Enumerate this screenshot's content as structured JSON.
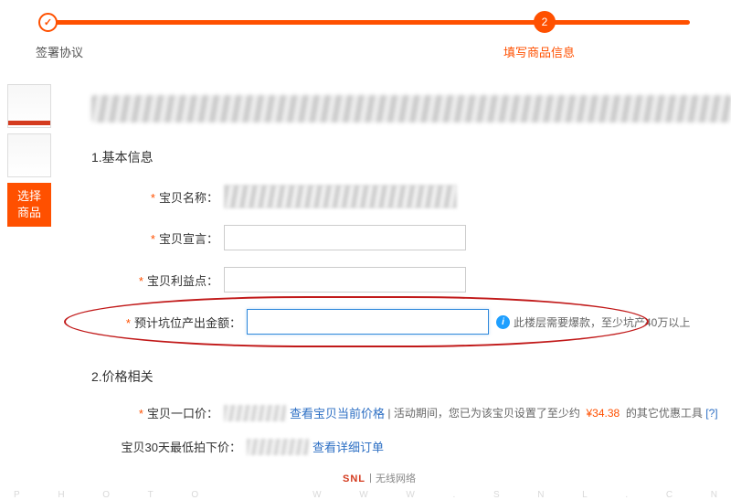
{
  "progress": {
    "step1_label": "签署协议",
    "step2_label": "填写商品信息",
    "step2_number": "2"
  },
  "left_rail": {
    "select_btn": "选择\n商品"
  },
  "sections": {
    "basic_title": "1.基本信息",
    "price_title": "2.价格相关"
  },
  "basic": {
    "name_label": "宝贝名称：",
    "slogan_label": "宝贝宣言：",
    "benefit_label": "宝贝利益点：",
    "gmv_label": "预计坑位产出金额：",
    "gmv_hint": "此楼层需要爆款，至少坑产40万以上"
  },
  "price": {
    "fixed_label": "宝贝一口价：",
    "view_current": "查看宝贝当前价格",
    "fixed_hint_prefix": "活动期间，您已为该宝贝设置了至少约",
    "fixed_hint_amount": "¥34.38",
    "fixed_hint_suffix": "的其它优惠工具",
    "help_q": "[?]",
    "lowest30_label": "宝贝30天最低拍下价：",
    "view_detail": "查看详细订单"
  },
  "watermark": {
    "logo_main": "SNL",
    "logo_tail": "丨无线网络",
    "letters": [
      "P",
      "H",
      "O",
      "T",
      "O",
      "",
      "W",
      "W",
      "W",
      ".",
      "S",
      "N",
      "L",
      ".",
      "C",
      "N"
    ]
  }
}
